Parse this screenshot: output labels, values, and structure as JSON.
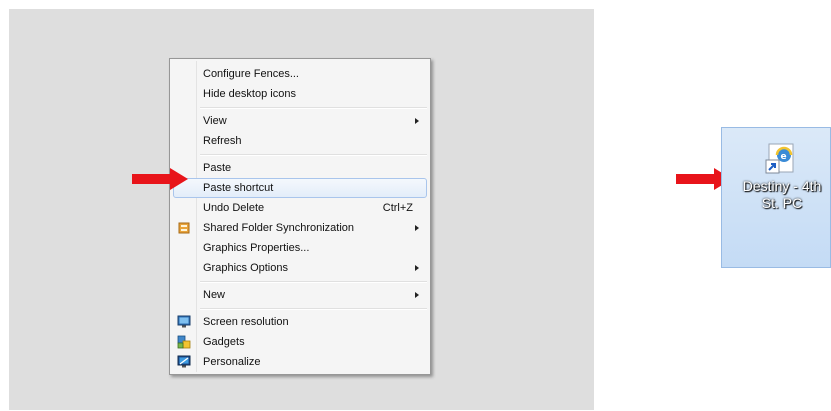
{
  "menu": {
    "items": [
      {
        "label": "Configure Fences...",
        "icon": ""
      },
      {
        "label": "Hide desktop icons",
        "icon": ""
      },
      {
        "label": "View",
        "submenu": true
      },
      {
        "label": "Refresh"
      },
      {
        "label": "Paste"
      },
      {
        "label": "Paste shortcut",
        "highlighted": true
      },
      {
        "label": "Undo Delete",
        "shortcut": "Ctrl+Z"
      },
      {
        "label": "Shared Folder Synchronization",
        "submenu": true,
        "icon": "sync-icon"
      },
      {
        "label": "Graphics Properties..."
      },
      {
        "label": "Graphics Options",
        "submenu": true
      },
      {
        "label": "New",
        "submenu": true
      },
      {
        "label": "Screen resolution",
        "icon": "monitor-icon"
      },
      {
        "label": "Gadgets",
        "icon": "gadgets-icon"
      },
      {
        "label": "Personalize",
        "icon": "personalize-icon"
      }
    ]
  },
  "shortcut_icon": {
    "label_line1": "Destiny - 4th",
    "label_line2": "St. PC",
    "icon": "internet-shortcut-icon"
  },
  "colors": {
    "arrow": "#e8141a",
    "desktop": "#dedede",
    "highlight_border": "#a9c5ec"
  }
}
